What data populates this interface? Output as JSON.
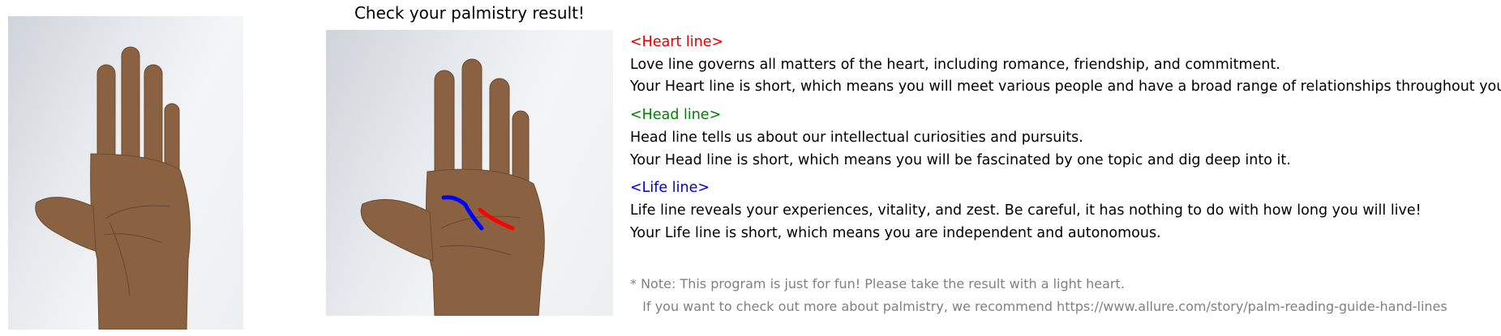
{
  "title": "Check your palmistry result!",
  "colors": {
    "heart": "#e00000",
    "head": "#008000",
    "life": "#0000cc",
    "note": "#808080"
  },
  "heart": {
    "header": "<Heart line>",
    "desc": "Love line governs all matters of the heart, including romance, friendship, and commitment.",
    "result": "Your Heart line is short, which means you will meet various people and have a broad range of relationships throughout your life."
  },
  "head": {
    "header": "<Head line>",
    "desc": "Head line tells us about our intellectual curiosities and pursuits.",
    "result": "Your Head line is short, which means you will be fascinated by one topic and dig deep into it."
  },
  "life": {
    "header": "<Life line>",
    "desc": "Life line reveals your experiences, vitality, and zest. Be careful, it has nothing to do with how long you will live!",
    "result": "Your Life line is short, which means you are independent and autonomous."
  },
  "note": {
    "line1": "* Note: This program is just for fun! Please take the result with a light heart.",
    "line2": "   If you want to check out more about palmistry, we recommend https://www.allure.com/story/palm-reading-guide-hand-lines"
  }
}
